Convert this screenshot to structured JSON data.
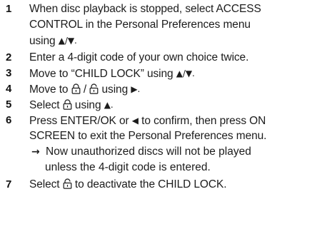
{
  "steps": [
    {
      "number": "1",
      "lines": [
        "When disc playback is stopped, select ACCESS",
        "CONTROL in the Personal Preferences menu",
        "using"
      ],
      "arrows": "▲/▼."
    },
    {
      "number": "2",
      "text": "Enter a 4-digit code of your own choice twice."
    },
    {
      "number": "3",
      "text_before": "Move to “CHILD LOCK” using",
      "arrows": "▲/▼."
    },
    {
      "number": "4",
      "text_before": "Move to",
      "separator": "/",
      "text_after": "using",
      "arrow": "▶."
    },
    {
      "number": "5",
      "text_before": "Select",
      "text_after": "using",
      "arrow": "▲."
    },
    {
      "number": "6",
      "line1_before": "Press ENTER/OK or",
      "arrow": "◀",
      "line1_after": "to confirm, then press ON",
      "line2": "SCREEN to exit the Personal Preferences menu.",
      "note_arrow": "→",
      "note_line1": "Now unauthorized discs will not be played",
      "note_line2": "unless the 4-digit code is entered."
    },
    {
      "number": "7",
      "text_before": "Select",
      "text_after": "to deactivate the CHILD LOCK."
    }
  ],
  "icons": {
    "locked": "lock-closed-icon",
    "unlocked": "lock-open-icon"
  }
}
